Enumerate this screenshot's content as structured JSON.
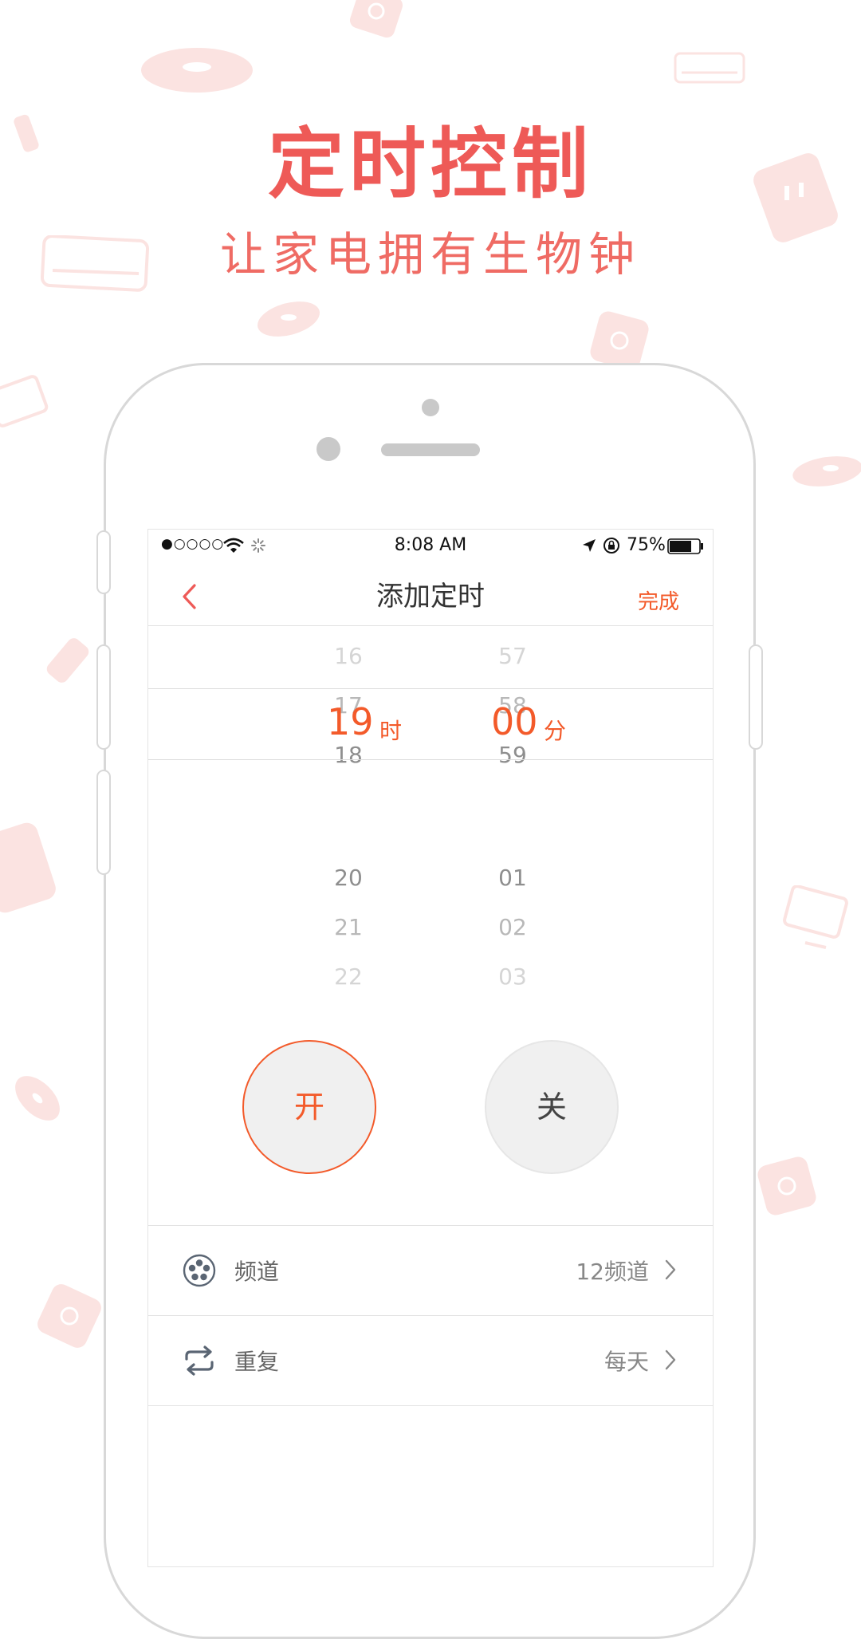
{
  "promo": {
    "title": "定时控制",
    "subtitle": "让家电拥有生物钟"
  },
  "statusbar": {
    "time": "8:08 AM",
    "battery": "75%",
    "battery_level": 0.75,
    "signal_dots": "●○○○○"
  },
  "nav": {
    "title": "添加定时",
    "done_label": "完成"
  },
  "picker": {
    "hours_above": [
      "16",
      "17",
      "18"
    ],
    "hour_selected": "19",
    "hour_unit": "时",
    "hours_below": [
      "20",
      "21",
      "22"
    ],
    "minutes_above": [
      "57",
      "58",
      "59"
    ],
    "minute_selected": "00",
    "minute_unit": "分",
    "minutes_below": [
      "01",
      "02",
      "03"
    ]
  },
  "buttons": {
    "on_label": "开",
    "off_label": "关"
  },
  "settings": [
    {
      "label": "频道",
      "value": "12频道",
      "icon": "channel-reel-icon"
    },
    {
      "label": "重复",
      "value": "每天",
      "icon": "repeat-icon"
    }
  ],
  "colors": {
    "accent": "#f35a2a",
    "headline": "#ee5a57",
    "decor": "#fbe3e1"
  }
}
